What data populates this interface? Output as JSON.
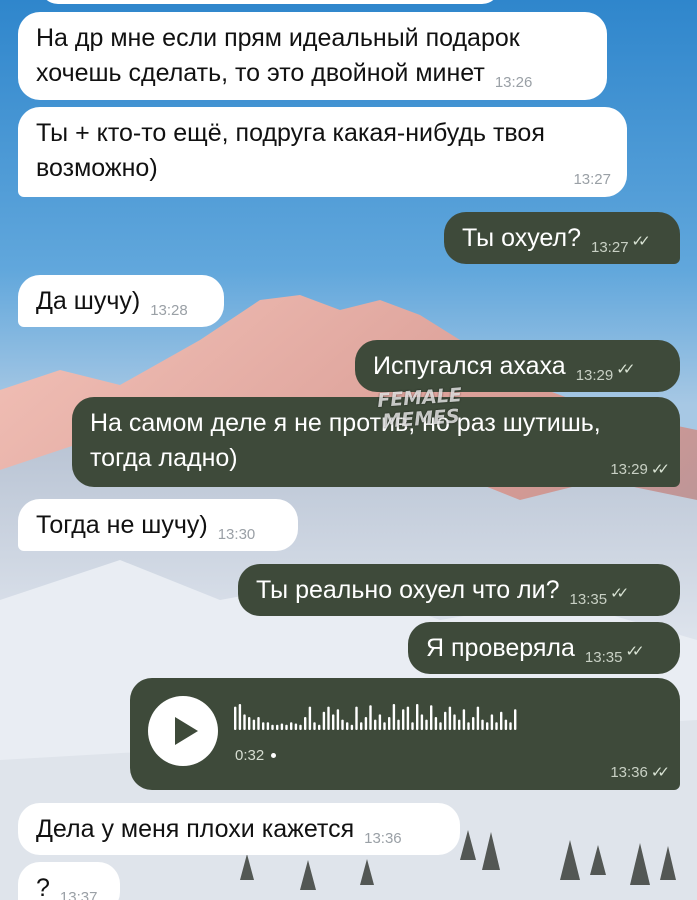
{
  "watermark": [
    "FEMALE",
    "MEMES"
  ],
  "messages": [
    {
      "side": "in",
      "text_lines": [
        "На др мне если прям идеальный подарок",
        "хочешь сделать, то это двойной минет"
      ],
      "time": "13:26"
    },
    {
      "side": "in",
      "text_lines": [
        "Ты + кто-то ещё, подруга какая-нибудь твоя",
        "возможно)"
      ],
      "time": "13:27"
    },
    {
      "side": "out",
      "text": "Ты охуел?",
      "time": "13:27",
      "read": true
    },
    {
      "side": "in",
      "text": "Да шучу)",
      "time": "13:28"
    },
    {
      "side": "out",
      "text": "Испугался ахаха",
      "time": "13:29",
      "read": true
    },
    {
      "side": "out",
      "text_lines": [
        "На самом деле я не против, но раз шутишь,",
        "тогда ладно)"
      ],
      "time": "13:29",
      "read": true
    },
    {
      "side": "in",
      "text": "Тогда не шучу)",
      "time": "13:30"
    },
    {
      "side": "out",
      "text": "Ты реально охуел что ли?",
      "time": "13:35",
      "read": true
    },
    {
      "side": "out",
      "text": "Я проверяла",
      "time": "13:35",
      "read": true
    },
    {
      "side": "out",
      "type": "voice",
      "duration": "0:32",
      "time": "13:36",
      "read": true,
      "icon": "play-icon"
    },
    {
      "side": "in",
      "text": "Дела у меня плохи кажется",
      "time": "13:36"
    },
    {
      "side": "in",
      "text": "?",
      "time": "13:37"
    }
  ],
  "colors": {
    "incoming_bubble": "#ffffff",
    "outgoing_bubble": "#3e4a3a"
  }
}
